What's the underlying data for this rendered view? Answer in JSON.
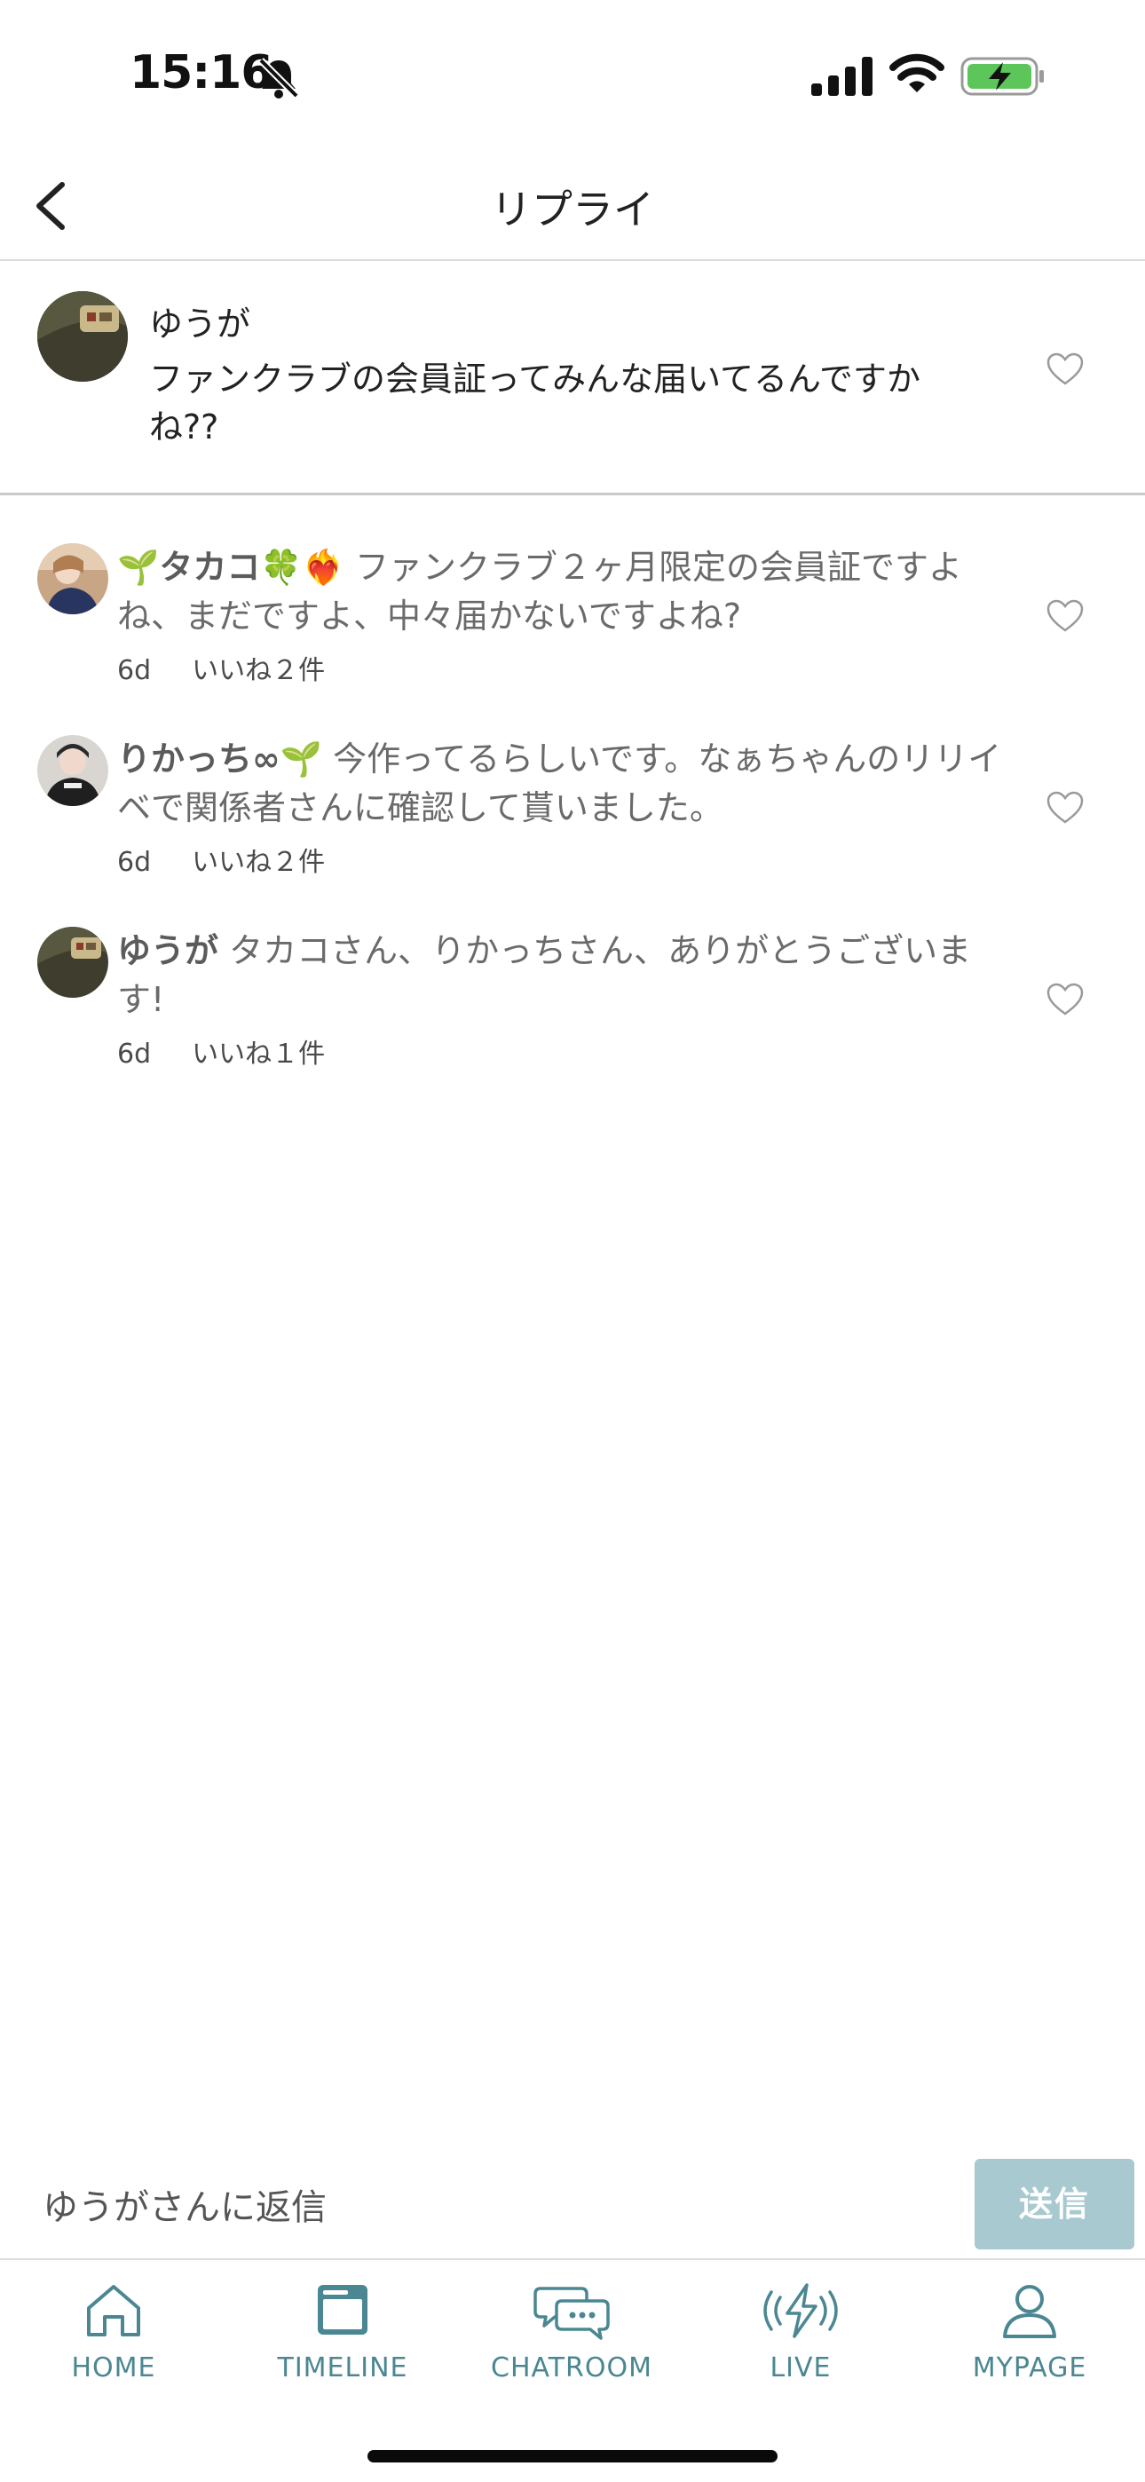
{
  "status_bar": {
    "time": "15:16",
    "icons": [
      "bell-slash-icon",
      "cellular-signal-icon",
      "wifi-icon",
      "battery-charging-icon"
    ],
    "battery_color": "#5cc65a"
  },
  "header": {
    "title": "リプライ",
    "back_icon": "chevron-left-icon"
  },
  "post": {
    "username": "ゆうが",
    "text": "ファンクラブの会員証ってみんな届いてるんですかね??",
    "like_icon": "heart-outline-icon"
  },
  "replies": [
    {
      "name": "🌱タカコ🍀❤️‍🔥",
      "text": " ファンクラブ２ヶ月限定の会員証ですよね、まだですよ、中々届かないですよね?",
      "time": "6d",
      "likes": "いいね２件"
    },
    {
      "name": "りかっち∞🌱",
      "text": " 今作ってるらしいです。なぁちゃんのリリイベで関係者さんに確認して貰いました。",
      "time": "6d",
      "likes": "いいね２件"
    },
    {
      "name": "ゆうが",
      "text": " タカコさん、りかっちさん、ありがとうございます!",
      "time": "6d",
      "likes": "いいね１件"
    }
  ],
  "composer": {
    "placeholder": "ゆうがさんに返信",
    "send_label": "送信",
    "send_color": "#a7c9cf"
  },
  "tabbar": {
    "accent_color": "#4b8792",
    "tabs": [
      {
        "label": "HOME",
        "icon": "home-icon"
      },
      {
        "label": "TIMELINE",
        "icon": "timeline-icon"
      },
      {
        "label": "CHATROOM",
        "icon": "chat-bubbles-icon"
      },
      {
        "label": "LIVE",
        "icon": "live-bolt-icon"
      },
      {
        "label": "MYPAGE",
        "icon": "person-icon"
      }
    ]
  }
}
